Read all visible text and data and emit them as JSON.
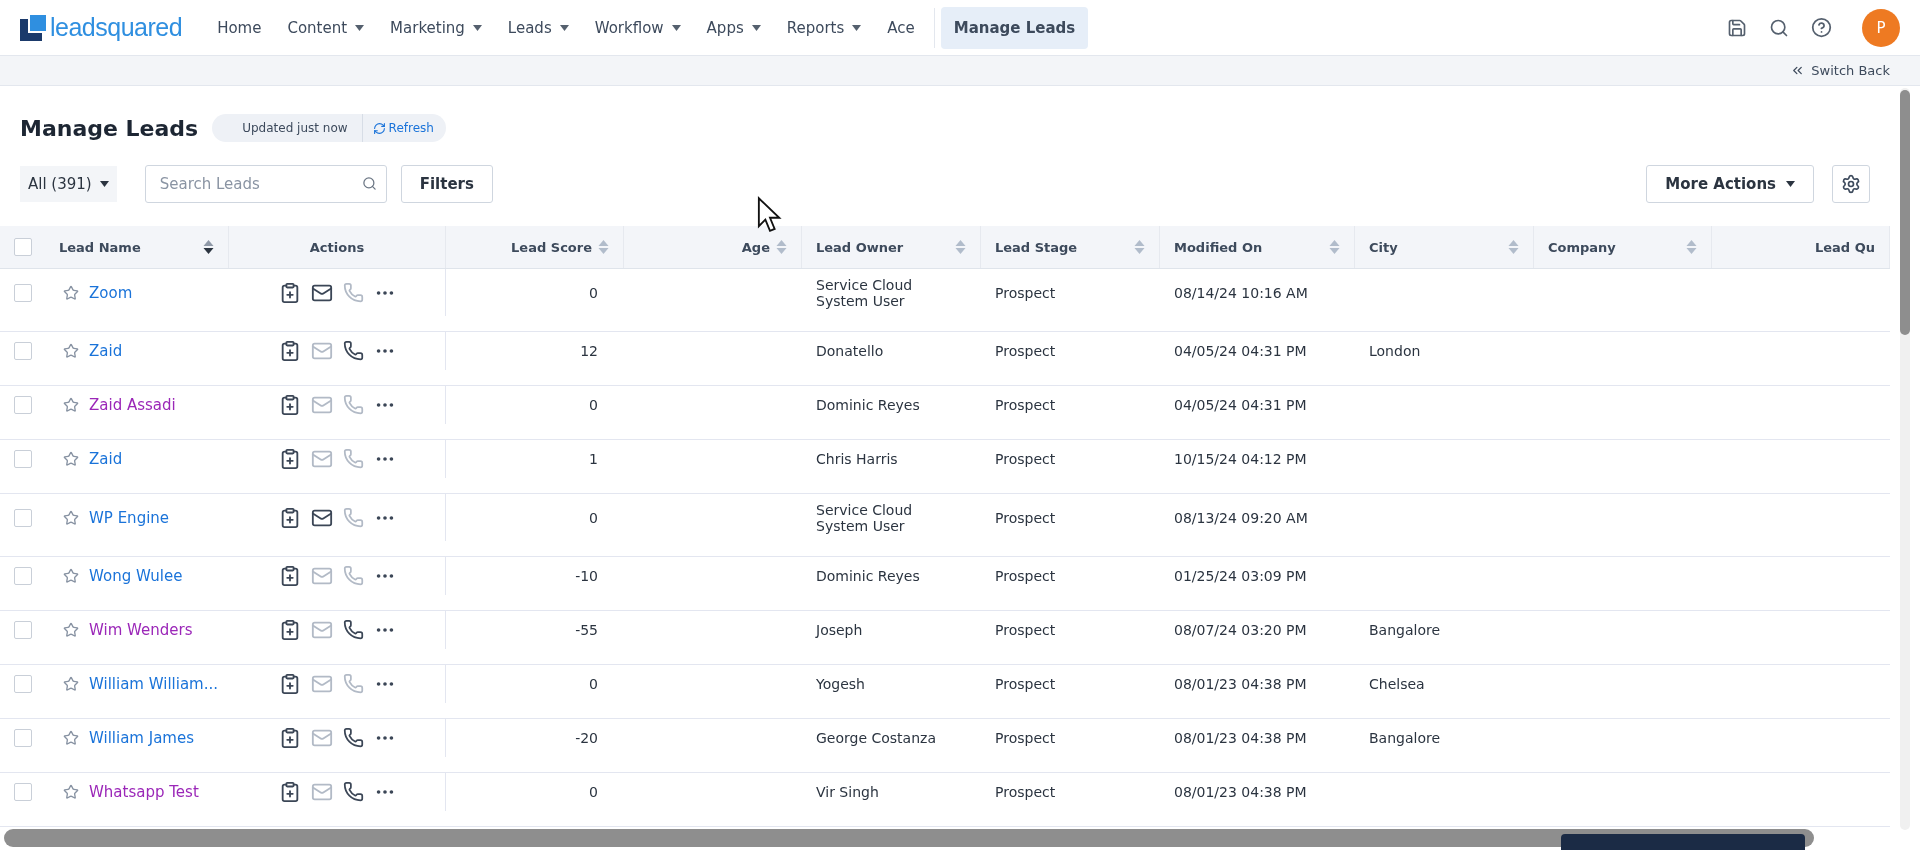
{
  "logo_text": "leadsquared",
  "nav": [
    {
      "label": "Home",
      "has_menu": false,
      "selected": false
    },
    {
      "label": "Content",
      "has_menu": true,
      "selected": false
    },
    {
      "label": "Marketing",
      "has_menu": true,
      "selected": false
    },
    {
      "label": "Leads",
      "has_menu": true,
      "selected": false
    },
    {
      "label": "Workflow",
      "has_menu": true,
      "selected": false
    },
    {
      "label": "Apps",
      "has_menu": true,
      "selected": false
    },
    {
      "label": "Reports",
      "has_menu": true,
      "selected": false
    },
    {
      "label": "Ace",
      "has_menu": false,
      "selected": false
    },
    {
      "label": "Manage Leads",
      "has_menu": false,
      "selected": true
    }
  ],
  "avatar_initial": "P",
  "switch_back": "Switch Back",
  "page_title": "Manage Leads",
  "update_status": "Updated just now",
  "refresh": "Refresh",
  "filter_view": "All (391)",
  "search": {
    "placeholder": "Search Leads"
  },
  "filters_button": "Filters",
  "more_actions": "More Actions",
  "table": {
    "select_all_checked": false,
    "columns": [
      {
        "label": "Lead Name",
        "sorted": true
      },
      {
        "label": "Actions"
      },
      {
        "label": "Lead Score",
        "sorted": false
      },
      {
        "label": "Age",
        "sorted": false
      },
      {
        "label": "Lead Owner",
        "sorted": false
      },
      {
        "label": "Lead Stage",
        "sorted": false
      },
      {
        "label": "Modified On",
        "sorted": false
      },
      {
        "label": "City",
        "sorted": false
      },
      {
        "label": "Company",
        "sorted": false
      },
      {
        "label": "Lead Qu"
      }
    ],
    "rows": [
      {
        "checked": false,
        "name": "Zoom",
        "color": "#1a73d9",
        "email_enabled": true,
        "phone_enabled": false,
        "score": "0",
        "owner": "Service Cloud System User",
        "stage": "Prospect",
        "modified": "08/14/24 10:16 AM",
        "city": ""
      },
      {
        "checked": false,
        "name": "Zaid",
        "color": "#1a73d9",
        "email_enabled": false,
        "phone_enabled": true,
        "score": "12",
        "owner": "Donatello",
        "stage": "Prospect",
        "modified": "04/05/24 04:31 PM",
        "city": "London"
      },
      {
        "checked": false,
        "name": "Zaid Assadi",
        "color": "#9b27b8",
        "email_enabled": false,
        "phone_enabled": false,
        "score": "0",
        "owner": "Dominic Reyes",
        "stage": "Prospect",
        "modified": "04/05/24 04:31 PM",
        "city": ""
      },
      {
        "checked": false,
        "name": "Zaid",
        "color": "#1a73d9",
        "email_enabled": false,
        "phone_enabled": false,
        "score": "1",
        "owner": "Chris Harris",
        "stage": "Prospect",
        "modified": "10/15/24 04:12 PM",
        "city": ""
      },
      {
        "checked": false,
        "name": "WP Engine",
        "color": "#1a73d9",
        "email_enabled": true,
        "phone_enabled": false,
        "score": "0",
        "owner": "Service Cloud System User",
        "stage": "Prospect",
        "modified": "08/13/24 09:20 AM",
        "city": ""
      },
      {
        "checked": false,
        "name": "Wong Wulee",
        "color": "#1a73d9",
        "email_enabled": false,
        "phone_enabled": false,
        "score": "-10",
        "owner": "Dominic Reyes",
        "stage": "Prospect",
        "modified": "01/25/24 03:09 PM",
        "city": ""
      },
      {
        "checked": false,
        "name": "Wim Wenders",
        "color": "#9b27b8",
        "email_enabled": false,
        "phone_enabled": true,
        "score": "-55",
        "owner": "Joseph",
        "stage": "Prospect",
        "modified": "08/07/24 03:20 PM",
        "city": "Bangalore"
      },
      {
        "checked": false,
        "name": "William William...",
        "color": "#1a73d9",
        "email_enabled": false,
        "phone_enabled": false,
        "score": "0",
        "owner": "Yogesh",
        "stage": "Prospect",
        "modified": "08/01/23 04:38 PM",
        "city": "Chelsea"
      },
      {
        "checked": false,
        "name": "William James",
        "color": "#1a73d9",
        "email_enabled": false,
        "phone_enabled": true,
        "score": "-20",
        "owner": "George Costanza",
        "stage": "Prospect",
        "modified": "08/01/23 04:38 PM",
        "city": "Bangalore"
      },
      {
        "checked": false,
        "name": "Whatsapp Test",
        "color": "#9b27b8",
        "email_enabled": false,
        "phone_enabled": true,
        "score": "0",
        "owner": "Vir Singh",
        "stage": "Prospect",
        "modified": "08/01/23 04:38 PM",
        "city": ""
      }
    ]
  }
}
